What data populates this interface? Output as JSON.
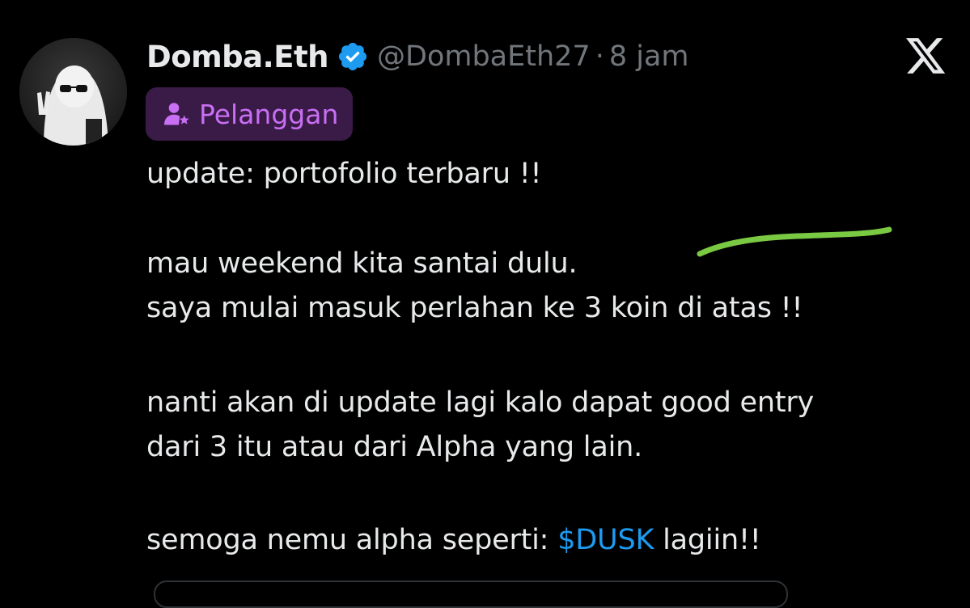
{
  "author": {
    "display_name": "Domba.Eth",
    "handle": "@DombaEth27",
    "separator": "·",
    "timestamp": "8 jam",
    "verified": true,
    "verified_color": "#1d9bf0"
  },
  "subscriber_badge": {
    "label": "Pelanggan",
    "icon": "subscriber-star-icon",
    "color": "#c86ff3",
    "background": "#3a1a47"
  },
  "platform_logo": "x-logo-icon",
  "tweet": {
    "line1": "update: portofolio terbaru !!",
    "line2": "mau weekend kita santai dulu.",
    "line3": "saya mulai masuk perlahan ke 3 koin di atas !!",
    "line4": "nanti akan di update lagi kalo dapat good entry",
    "line5": "dari 3 itu atau dari Alpha yang lain.",
    "line6_prefix": "semoga nemu alpha seperti: ",
    "line6_cashtag": "$DUSK",
    "line6_suffix": " lagiin!!"
  },
  "annotation": {
    "type": "highlighter-stroke",
    "color": "#7ac943"
  },
  "colors": {
    "background": "#000000",
    "text": "#e7e9ea",
    "muted": "#71767b",
    "link": "#1d9bf0"
  }
}
